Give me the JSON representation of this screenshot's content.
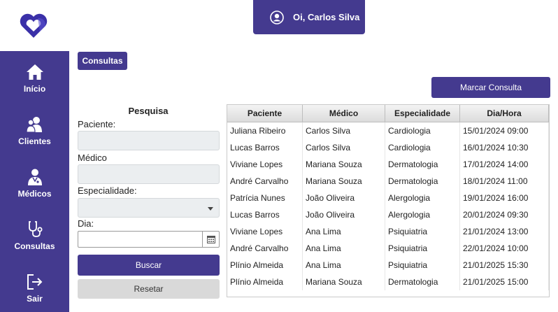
{
  "header": {
    "greeting": "Oi, Carlos Silva"
  },
  "colors": {
    "primary": "#443a8f",
    "field_bg": "#ebeef0",
    "secondary_button": "#d9d9d9"
  },
  "sidebar": {
    "items": [
      {
        "label": "Início",
        "icon": "home-icon"
      },
      {
        "label": "Clientes",
        "icon": "users-icon"
      },
      {
        "label": "Médicos",
        "icon": "doctor-icon"
      },
      {
        "label": "Consultas",
        "icon": "stethoscope-icon"
      },
      {
        "label": "Sair",
        "icon": "logout-icon"
      }
    ]
  },
  "page": {
    "section_tab": "Consultas",
    "schedule_button": "Marcar Consulta"
  },
  "search": {
    "title": "Pesquisa",
    "patient_label": "Paciente:",
    "patient_value": "",
    "doctor_label": "Médico",
    "doctor_value": "",
    "specialty_label": "Especialidade:",
    "specialty_value": "",
    "day_label": "Dia:",
    "day_value": "",
    "search_button": "Buscar",
    "reset_button": "Resetar"
  },
  "table": {
    "columns": [
      "Paciente",
      "Médico",
      "Especialidade",
      "Dia/Hora"
    ],
    "rows": [
      [
        "Juliana Ribeiro",
        "Carlos Silva",
        "Cardiologia",
        "15/01/2024 09:00"
      ],
      [
        "Lucas Barros",
        "Carlos Silva",
        "Cardiologia",
        "16/01/2024 10:30"
      ],
      [
        "Viviane Lopes",
        "Mariana Souza",
        "Dermatologia",
        "17/01/2024 14:00"
      ],
      [
        "André Carvalho",
        "Mariana Souza",
        "Dermatologia",
        "18/01/2024 11:00"
      ],
      [
        "Patrícia Nunes",
        "João Oliveira",
        "Alergologia",
        "19/01/2024 16:00"
      ],
      [
        "Lucas Barros",
        "João Oliveira",
        "Alergologia",
        "20/01/2024 09:30"
      ],
      [
        "Viviane Lopes",
        "Ana Lima",
        "Psiquiatria",
        "21/01/2024 13:00"
      ],
      [
        "André Carvalho",
        "Ana Lima",
        "Psiquiatria",
        "22/01/2024 10:00"
      ],
      [
        "Plínio Almeida",
        "Ana Lima",
        "Psiquiatria",
        "21/01/2025 15:30"
      ],
      [
        "Plínio Almeida",
        "Mariana Souza",
        "Dermatologia",
        "21/01/2025 15:00"
      ]
    ]
  }
}
